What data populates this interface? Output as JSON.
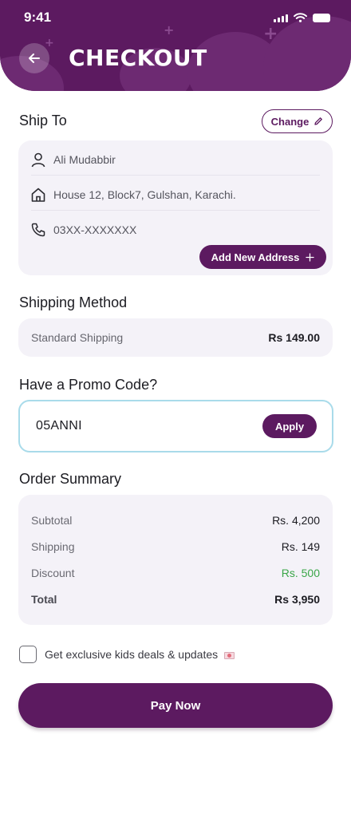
{
  "status_bar": {
    "time": "9:41"
  },
  "header": {
    "title": "CHECKOUT"
  },
  "ship_to": {
    "title": "Ship To",
    "change_label": "Change",
    "name": "Ali Mudabbir",
    "address": "House 12, Block7, Gulshan, Karachi.",
    "phone": "03XX-XXXXXXX",
    "add_address_label": "Add New Address"
  },
  "shipping_method": {
    "title": "Shipping Method",
    "name": "Standard Shipping",
    "price": "Rs 149.00"
  },
  "promo": {
    "title": "Have a Promo Code?",
    "code": "05ANNI",
    "apply_label": "Apply"
  },
  "order_summary": {
    "title": "Order Summary",
    "rows": [
      {
        "label": "Subtotal",
        "value": "Rs. 4,200"
      },
      {
        "label": "Shipping",
        "value": "Rs. 149"
      },
      {
        "label": "Discount",
        "value": "Rs. 500"
      },
      {
        "label": "Total",
        "value": "Rs 3,950"
      }
    ]
  },
  "newsletter": {
    "label": "Get exclusive kids deals & updates"
  },
  "pay_label": "Pay Now",
  "colors": {
    "primary": "#5c1a60",
    "discount": "#3aa648",
    "promo_border": "#a9dbea",
    "card_bg": "#f4f2f8"
  },
  "icons": [
    "arrow-left-icon",
    "signal-icon",
    "wifi-icon",
    "battery-icon",
    "pencil-icon",
    "user-icon",
    "home-icon",
    "phone-icon",
    "plus-icon",
    "mail-icon"
  ]
}
